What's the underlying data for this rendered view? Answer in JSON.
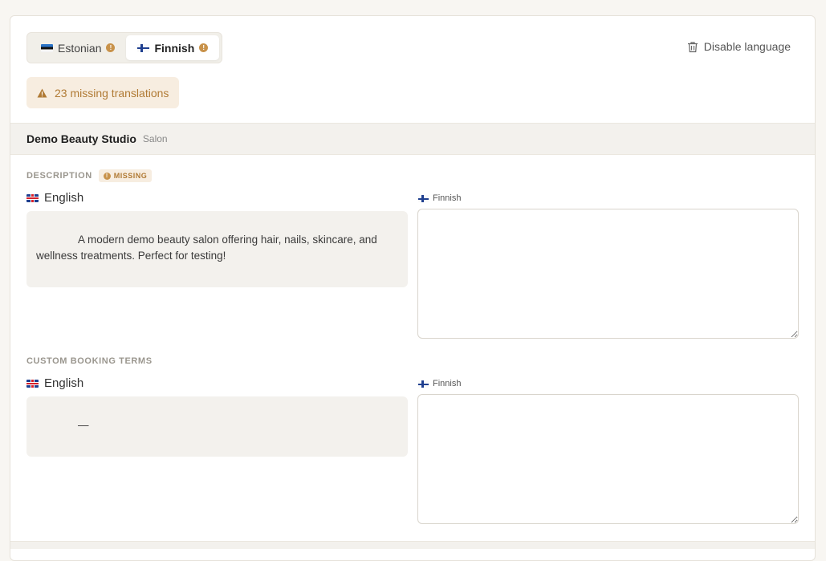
{
  "language_tabs": [
    {
      "label": "Estonian",
      "flag": "estonia-flag-icon",
      "status": "missing"
    },
    {
      "label": "Finnish",
      "flag": "finland-flag-icon",
      "status": "missing",
      "active": true
    }
  ],
  "disable_language_label": "Disable language",
  "missing_banner": "23 missing translations",
  "entity": {
    "name": "Demo Beauty Studio",
    "type": "Salon"
  },
  "fields": {
    "description": {
      "label": "DESCRIPTION",
      "missing_tag": "MISSING",
      "source_lang": "English",
      "source_text": "A modern demo beauty salon offering hair, nails, skincare, and wellness treatments. Perfect for testing!",
      "target_lang": "Finnish",
      "target_value": ""
    },
    "custom_booking_terms": {
      "label": "CUSTOM BOOKING TERMS",
      "source_lang": "English",
      "source_text": "—",
      "target_lang": "Finnish",
      "target_value": ""
    }
  },
  "colors": {
    "accent_warning": "#c8924a",
    "warning_bg": "#f7ede0",
    "page_bg": "#f8f6f2"
  }
}
